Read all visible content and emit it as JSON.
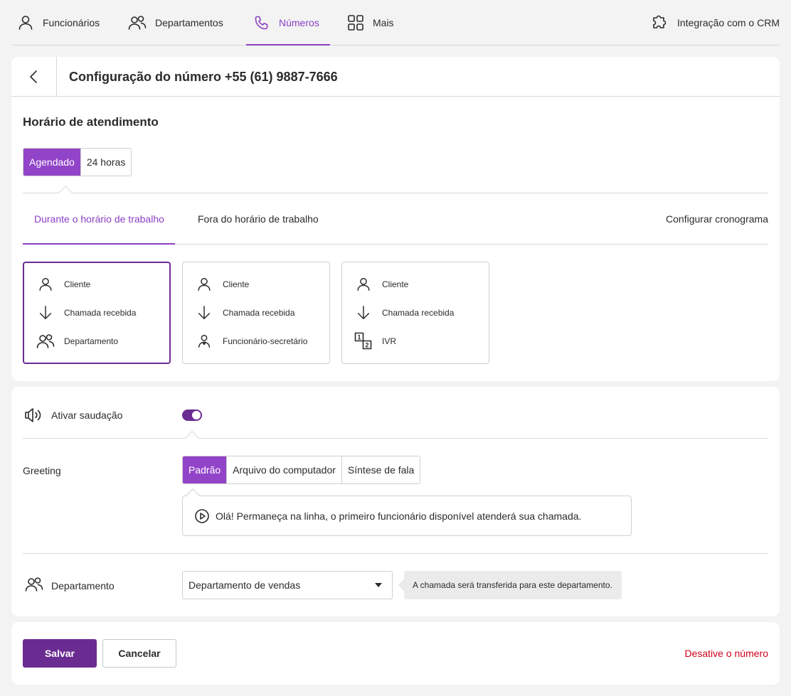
{
  "nav": {
    "items": [
      {
        "label": "Funcionários",
        "icon": "user-icon"
      },
      {
        "label": "Departamentos",
        "icon": "users-icon"
      },
      {
        "label": "Números",
        "icon": "phone-icon",
        "active": true
      },
      {
        "label": "Mais",
        "icon": "grid-icon"
      }
    ],
    "crm_label": "Integração com o CRM"
  },
  "header": {
    "title": "Configuração do número +55 (61) 9887-7666"
  },
  "hours": {
    "title": "Horário de atendimento",
    "modes": [
      "Agendado",
      "24 horas"
    ],
    "selected_mode": "Agendado"
  },
  "tabs": {
    "during": "Durante o horário de trabalho",
    "outside": "Fora do horário de trabalho",
    "schedule": "Configurar cronograma"
  },
  "schemes": [
    {
      "rows": [
        "Cliente",
        "Chamada recebida",
        "Departamento"
      ],
      "selected": true
    },
    {
      "rows": [
        "Cliente",
        "Chamada recebida",
        "Funcionário-secretário"
      ]
    },
    {
      "rows": [
        "Cliente",
        "Chamada recebida",
        "IVR"
      ]
    }
  ],
  "greeting": {
    "toggle_label": "Ativar saudação",
    "enabled": true,
    "label": "Greeting",
    "sources": [
      "Padrão",
      "Arquivo do computador",
      "Síntese de fala"
    ],
    "selected_source": "Padrão",
    "message": "Olá! Permaneça na linha, o primeiro funcionário disponível atenderá sua chamada."
  },
  "department": {
    "label": "Departamento",
    "value": "Departamento de vendas",
    "hint": "A chamada será transferida para este departamento."
  },
  "footer": {
    "save": "Salvar",
    "cancel": "Cancelar",
    "deactivate": "Desative o número"
  },
  "colors": {
    "accent": "#8c3fc4",
    "accent_dark": "#6b2c91",
    "danger": "#d0021b"
  }
}
